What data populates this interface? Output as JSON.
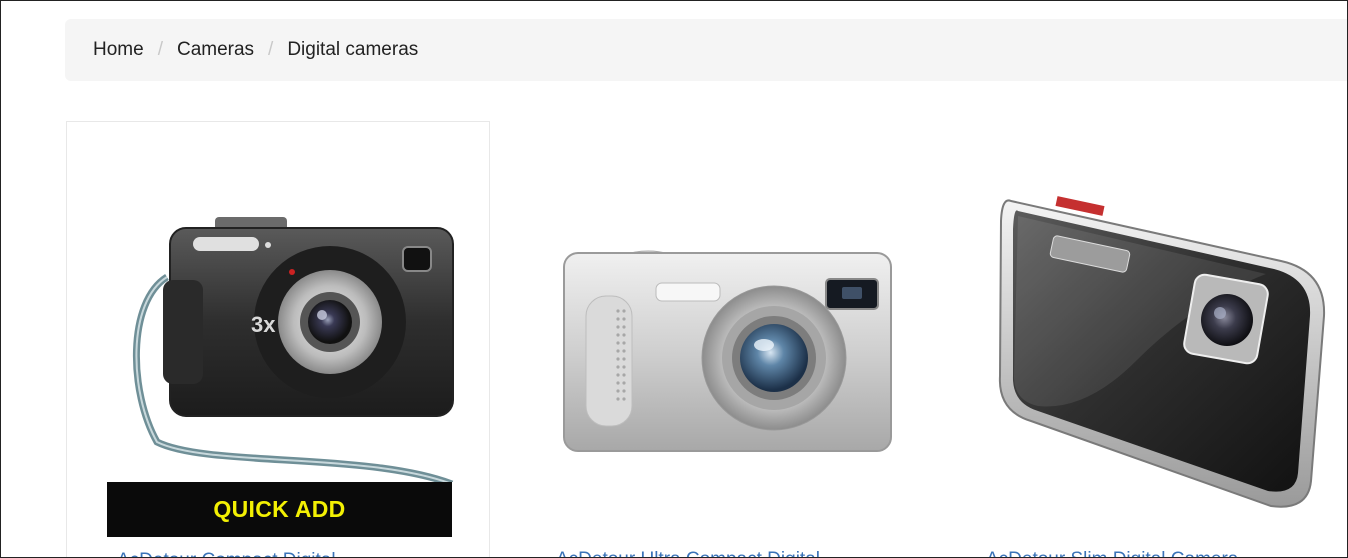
{
  "breadcrumb": {
    "items": [
      {
        "label": "Home"
      },
      {
        "label": "Cameras"
      },
      {
        "label": "Digital cameras"
      }
    ],
    "separator": "/"
  },
  "products": [
    {
      "title": "AcDetour Compact Digital",
      "camera_label": "3x",
      "quick_add": "QUICK ADD"
    },
    {
      "title": "AcDetour Ultra Compact Digital"
    },
    {
      "title": "AcDetour Slim Digital Camera"
    }
  ],
  "colors": {
    "link": "#3a73b8",
    "quick_add_bg": "#0a0a0a",
    "quick_add_text": "#f3f003",
    "breadcrumb_bg": "#f5f5f5"
  }
}
